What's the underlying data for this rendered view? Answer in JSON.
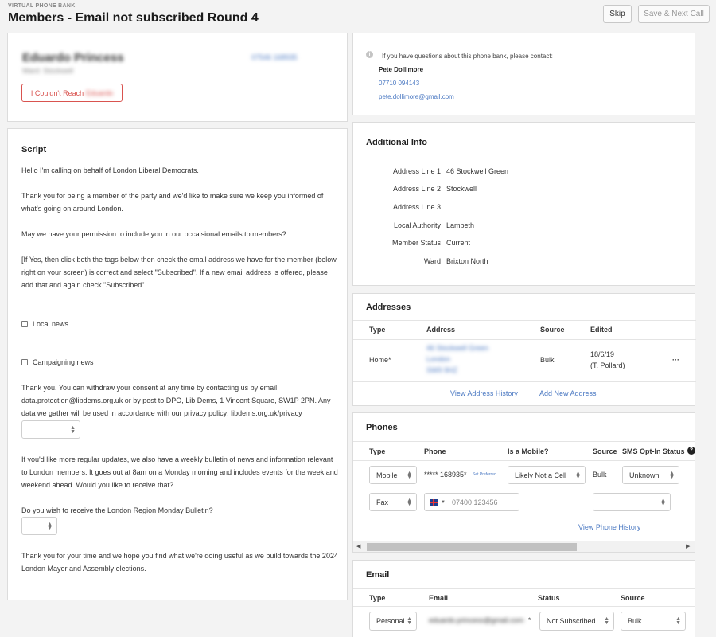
{
  "header": {
    "eyebrow": "VIRTUAL PHONE BANK",
    "title": "Members - Email not subscribed Round 4",
    "skip_label": "Skip",
    "save_next_label": "Save & Next Call"
  },
  "contact_card": {
    "name": "Eduardo Princess",
    "sub": "Ward: Stockwell",
    "phone_link": "07546 168935",
    "couldnt_reach_label": "I Couldn't Reach",
    "couldnt_reach_name": "Eduardo"
  },
  "info_card": {
    "note": "If you have questions about this phone bank, please contact:",
    "contact_name": "Pete Dollimore",
    "phone": "07710 094143",
    "email": "pete.dollimore@gmail.com"
  },
  "script": {
    "heading": "Script",
    "p1": "Hello I'm calling on behalf of London Liberal Democrats.",
    "p2": "Thank you for being a member of the party and we'd like to make sure we keep you informed of what's going on around London.",
    "p3": "May we have your permission to include you in our occaisional emails to members?",
    "p4": "[If Yes, then click both the tags below then check the email address we have for the member (below, right on your screen) is correct and select \"Subscribed\". If a new email address is offered, please add that and again check \"Subscribed\"",
    "tag1": "Local news",
    "tag2": "Campaigning news",
    "p5": "Thank you. You can withdraw your consent at any time by contacting us by email data.protection@libdems.org.uk or by post to DPO, Lib Dems, 1 Vincent Square, SW1P 2PN. Any data we gather will be used in accordance with our privacy policy: libdems.org.uk/privacy",
    "p6": "If you'd like more regular updates, we also have a weekly bulletin of news and information relevant to London members. It goes out at 8am on a Monday morning and includes events for the week and weekend ahead. Would you like to receive that?",
    "p7": "Do you wish to receive the London Region Monday Bulletin?",
    "p8": "Thank you for your time and we hope you find what we're doing useful as we build towards the 2024 London Mayor and Assembly elections."
  },
  "additional_info": {
    "heading": "Additional Info",
    "rows": [
      {
        "label": "Address Line 1",
        "value": "46 Stockwell Green"
      },
      {
        "label": "Address Line 2",
        "value": "Stockwell"
      },
      {
        "label": "Address Line 3",
        "value": ""
      },
      {
        "label": "Local Authority",
        "value": "Lambeth"
      },
      {
        "label": "Member Status",
        "value": "Current"
      },
      {
        "label": "Ward",
        "value": "Brixton North"
      }
    ]
  },
  "addresses": {
    "heading": "Addresses",
    "columns": [
      "Type",
      "Address",
      "Source",
      "Edited"
    ],
    "row": {
      "type": "Home*",
      "address_l1": "46 Stockwell Green",
      "address_l2": "London",
      "address_l3": "SW9 9HZ",
      "source": "Bulk",
      "edited": "18/6/19",
      "edited_by": "(T. Pollard)",
      "more": "···"
    },
    "history_link": "View Address History",
    "add_link": "Add New Address"
  },
  "phones": {
    "heading": "Phones",
    "columns": [
      "Type",
      "Phone",
      "Is a Mobile?",
      "Source",
      "SMS Opt-In Status"
    ],
    "row1": {
      "type": "Mobile",
      "phone": "***** 168935*",
      "set_preferred": "Set Preferred",
      "mobile": "Likely Not a Cell",
      "source": "Bulk",
      "sms": "Unknown"
    },
    "row2": {
      "type": "Fax",
      "phone_placeholder": "07400 123456",
      "sms": ""
    },
    "history_link": "View Phone History"
  },
  "email": {
    "heading": "Email",
    "columns": [
      "Type",
      "Email",
      "Status",
      "Source"
    ],
    "row": {
      "type": "Personal",
      "email": "eduardo.princess@gmail.com",
      "star": "*",
      "status": "Not Subscribed",
      "source": "Bulk"
    }
  }
}
